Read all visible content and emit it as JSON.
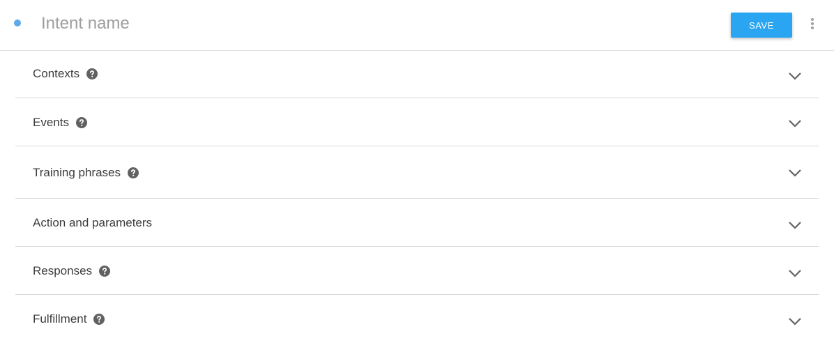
{
  "header": {
    "intent_placeholder": "Intent name",
    "save_label": "SAVE"
  },
  "colors": {
    "accent": "#2aa5f2",
    "status_dot": "#5da9e9",
    "help_icon": "#616161",
    "chevron": "#616161"
  },
  "sections": [
    {
      "label": "Contexts",
      "has_help": true,
      "icon": "chevron-down-icon"
    },
    {
      "label": "Events",
      "has_help": true,
      "icon": "chevron-down-icon"
    },
    {
      "label": "Training phrases",
      "has_help": true,
      "icon": "chevron-down-icon"
    },
    {
      "label": "Action and parameters",
      "has_help": false,
      "icon": "chevron-down-icon"
    },
    {
      "label": "Responses",
      "has_help": true,
      "icon": "chevron-down-icon"
    },
    {
      "label": "Fulfillment",
      "has_help": true,
      "icon": "chevron-down-icon"
    }
  ]
}
